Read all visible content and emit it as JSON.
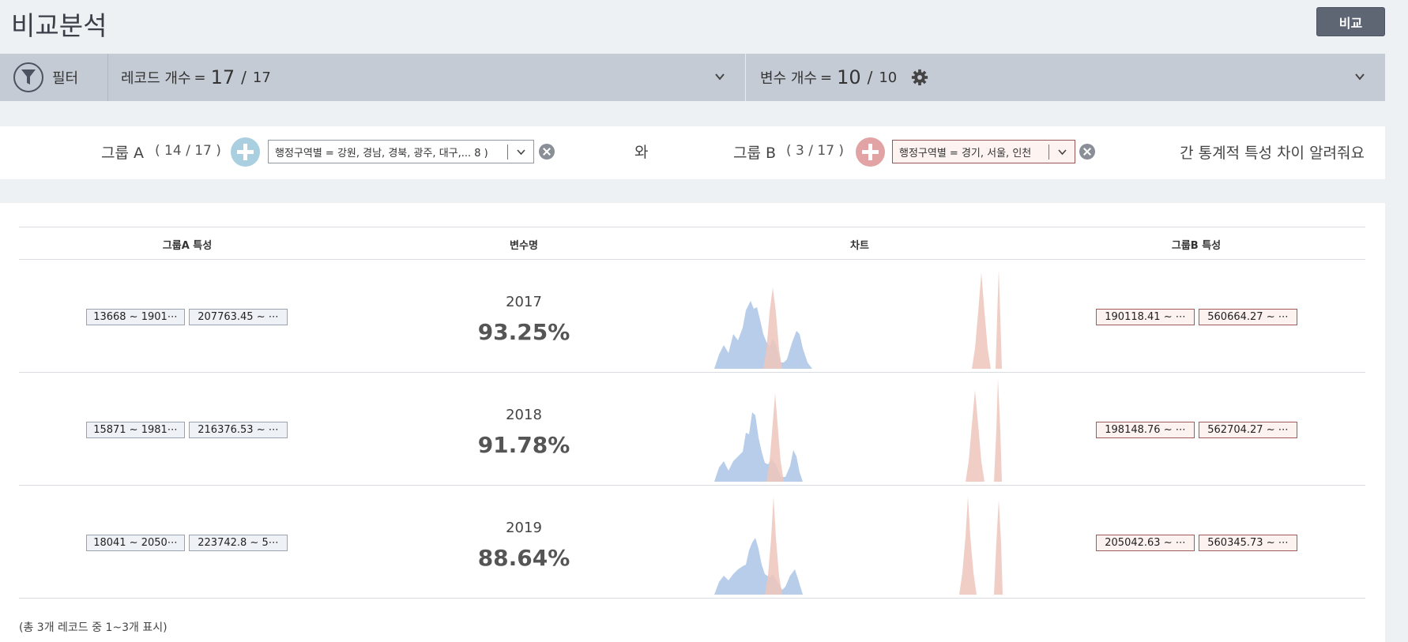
{
  "header": {
    "title": "비교분석",
    "compare_label": "비교"
  },
  "filterbar": {
    "filter_label": "필터",
    "records": {
      "label": "레코드 개수",
      "eq": "=",
      "current": "17",
      "slash": "/",
      "total": "17"
    },
    "variables": {
      "label": "변수 개수",
      "eq": "=",
      "current": "10",
      "slash": "/",
      "total": "10"
    }
  },
  "groups": {
    "a": {
      "label": "그룹 A",
      "count": "( 14 / 17 )",
      "condition": "행정구역별 = 강원, 경남, 경북, 광주, 대구,... 8 )"
    },
    "connector": "와",
    "b": {
      "label": "그룹 B",
      "count": "( 3 / 17 )",
      "condition": "행정구역별 = 경기, 서울, 인천"
    },
    "suffix": "간 통계적 특성 차이 알려줘요"
  },
  "table": {
    "columns": [
      "그룹A 특성",
      "변수명",
      "차트",
      "그룹B 특성"
    ],
    "rows": [
      {
        "a_chips": [
          "13668 ~ 1901⋯",
          "207763.45 ~ ⋯"
        ],
        "name": "2017",
        "pct": "93.25%",
        "b_chips": [
          "190118.41 ~ ⋯",
          "560664.27 ~ ⋯"
        ]
      },
      {
        "a_chips": [
          "15871 ~ 1981⋯",
          "216376.53 ~ ⋯"
        ],
        "name": "2018",
        "pct": "91.78%",
        "b_chips": [
          "198148.76 ~ ⋯",
          "562704.27 ~ ⋯"
        ]
      },
      {
        "a_chips": [
          "18041 ~ 2050⋯",
          "223742.8 ~ 5⋯"
        ],
        "name": "2019",
        "pct": "88.64%",
        "b_chips": [
          "205042.63 ~ ⋯",
          "560345.73 ~ ⋯"
        ]
      }
    ],
    "footer": "(총 3개 레코드 중 1~3개 표시)"
  },
  "colors": {
    "group_a": "#aac4e6",
    "group_b": "#efc6bb",
    "button": "#5e6674",
    "filterbar": "#c5cbd5"
  },
  "icons": [
    "funnel-icon",
    "chevron-down-icon",
    "gear-icon",
    "plus-icon",
    "close-icon"
  ]
}
